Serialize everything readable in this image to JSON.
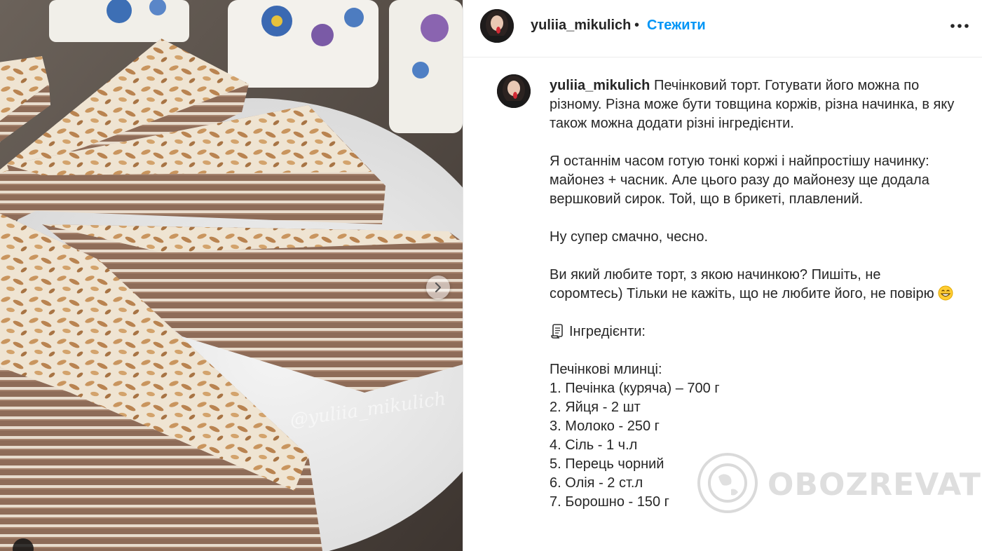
{
  "header": {
    "username": "yuliia_mikulich",
    "dot": "•",
    "follow_label": "Стежити"
  },
  "photo": {
    "watermark_text": "@yuliia_mikulich",
    "next_icon": "chevron-right-icon"
  },
  "caption": {
    "username": "yuliia_mikulich",
    "intro": "Печінковий торт. Готувати його можна по різному. Різна може бути товщина коржів, різна начинка, в яку також можна додати різні інгредієнти.",
    "p2": "Я останнім часом готую тонкі коржі і найпростішу начинку: майонез + часник. Але цього разу до майонезу ще додала вершковий сирок. Той, що в брикеті, плавлений.",
    "p3": "Ну супер смачно, чесно.",
    "p4": "Ви який любите торт, з якою начинкою? Пишіть, не соромтесь) Тільки не кажіть, що не любите його, не повірю",
    "ingredients_title": "Інгредієнти:",
    "section_title": "Печінкові млинці:",
    "items": [
      "1. Печінка (куряча) – 700 г",
      "2. Яйця - 2 шт",
      "3. Молоко - 250 г",
      "4. Сіль - 1 ч.л",
      "5. Перець чорний",
      "6. Олія - 2 ст.л",
      "7. Борошно - 150 г"
    ]
  },
  "watermark": {
    "text": "OBOZREVATEL"
  },
  "colors": {
    "link": "#0095f6",
    "text": "#262626",
    "border": "#ececec"
  }
}
